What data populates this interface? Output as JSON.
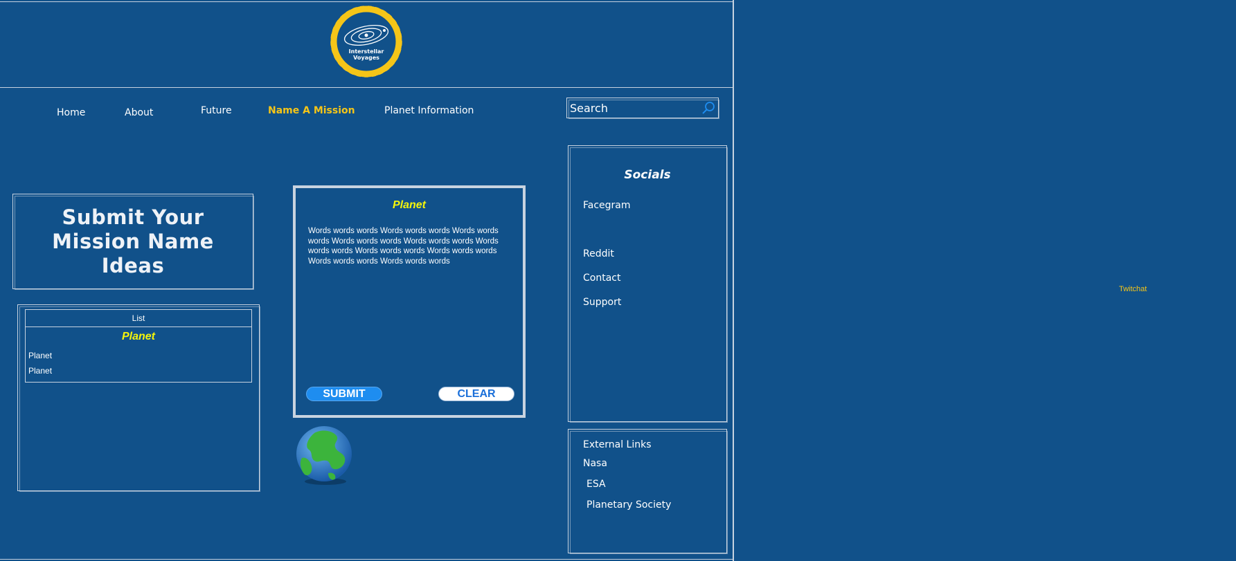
{
  "logo": {
    "line1": "Interstellar",
    "line2": "Voyages"
  },
  "nav": {
    "items": [
      {
        "label": "Home"
      },
      {
        "label": "About"
      },
      {
        "label": "Future"
      },
      {
        "label": "Name A Mission"
      },
      {
        "label": "Planet Information"
      }
    ]
  },
  "search": {
    "placeholder": "Search"
  },
  "mission": {
    "title": "Submit Your Mission Name Ideas"
  },
  "list_panel": {
    "header": "List",
    "title": "Planet",
    "items": [
      "Planet",
      "Planet"
    ]
  },
  "card": {
    "title": "Planet",
    "body": "Words words words Words words words Words words words Words words words Words words words Words words words Words words words Words words words Words words words Words words words",
    "submit_label": "SUBMIT",
    "clear_label": "CLEAR"
  },
  "socials": {
    "title": "Socials",
    "links": [
      "Facegram",
      "Reddit",
      "Contact",
      "Support"
    ]
  },
  "external": {
    "title": "External Links",
    "links": [
      "Nasa",
      "ESA",
      "Planetary Society"
    ]
  },
  "twitchat": "Twitchat",
  "colors": {
    "background": "#11518a",
    "accent": "#f5c518",
    "planet_title": "#f5f50a",
    "submit": "#1e8df0"
  }
}
